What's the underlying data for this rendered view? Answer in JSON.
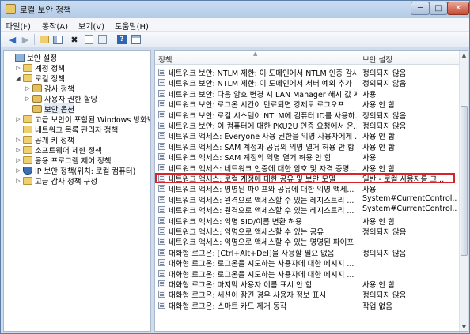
{
  "window": {
    "title": "로컬 보안 정책",
    "buttons": {
      "minimize": "─",
      "maximize": "□",
      "close": "✕"
    }
  },
  "menubar": {
    "items": [
      "파일(F)",
      "동작(A)",
      "보기(V)",
      "도움말(H)"
    ]
  },
  "toolbar": {
    "icons": [
      "back-icon",
      "forward-icon",
      "up-folder-icon",
      "show-hide-tree-icon",
      "delete-icon",
      "properties-icon",
      "export-list-icon",
      "help-icon",
      "view-icon"
    ]
  },
  "tree": {
    "items": [
      {
        "label": "보안 설정",
        "level": 0,
        "toggle": "",
        "icon": "computer-icon"
      },
      {
        "label": "계정 정책",
        "level": 1,
        "toggle": "▷",
        "icon": "folder-icon"
      },
      {
        "label": "로컬 정책",
        "level": 1,
        "toggle": "◢",
        "icon": "folder-icon"
      },
      {
        "label": "감사 정책",
        "level": 2,
        "toggle": "▷",
        "icon": "lock-folder-icon"
      },
      {
        "label": "사용자 권한 할당",
        "level": 2,
        "toggle": "▷",
        "icon": "lock-folder-icon"
      },
      {
        "label": "보안 옵션",
        "level": 2,
        "toggle": "",
        "icon": "lock-folder-icon",
        "selected": true
      },
      {
        "label": "고급 보안이 포함된 Windows 방화벽",
        "level": 1,
        "toggle": "▷",
        "icon": "folder-icon"
      },
      {
        "label": "네트워크 목록 관리자 정책",
        "level": 1,
        "toggle": "",
        "icon": "folder-icon"
      },
      {
        "label": "공개 키 정책",
        "level": 1,
        "toggle": "▷",
        "icon": "folder-icon"
      },
      {
        "label": "소프트웨어 제한 정책",
        "level": 1,
        "toggle": "▷",
        "icon": "folder-icon"
      },
      {
        "label": "응용 프로그램 제어 정책",
        "level": 1,
        "toggle": "▷",
        "icon": "folder-icon"
      },
      {
        "label": "IP 보안 정책(위치: 로컬 컴퓨터)",
        "level": 1,
        "toggle": "▷",
        "icon": "shield-icon"
      },
      {
        "label": "고급 감사 정책 구성",
        "level": 1,
        "toggle": "▷",
        "icon": "folder-icon"
      }
    ]
  },
  "list": {
    "columns": {
      "policy": "정책",
      "setting": "보안 설정"
    },
    "rows": [
      {
        "policy": "네트워크 보안: NTLM 제한: 이 도메인에서 NTLM 인증 감사",
        "setting": "정의되지 않음"
      },
      {
        "policy": "네트워크 보안: NTLM 제한: 이 도메인에서 서버 예외 추가",
        "setting": "정의되지 않음"
      },
      {
        "policy": "네트워크 보안: 다음 암호 변경 시 LAN Manager 해시 값 저...",
        "setting": "사용"
      },
      {
        "policy": "네트워크 보안: 로그온 시간이 만료되면 강제로 로그오프",
        "setting": "사용 안 함"
      },
      {
        "policy": "네트워크 보안: 로컬 시스템이 NTLM에 컴퓨터 ID를 사용하...",
        "setting": "정의되지 않음"
      },
      {
        "policy": "네트워크 보안: 이 컴퓨터에 대한 PKU2U 인증 요청에서 온...",
        "setting": "정의되지 않음"
      },
      {
        "policy": "네트워크 액세스: Everyone 사용 권한을 익명 사용자에게 ...",
        "setting": "사용 안 함"
      },
      {
        "policy": "네트워크 액세스: SAM 계정과 공유의 익명 열거 허용 안 함",
        "setting": "사용 안 함"
      },
      {
        "policy": "네트워크 액세스: SAM 계정의 익명 열거 허용 안 함",
        "setting": "사용"
      },
      {
        "policy": "네트워크 액세스: 네트워크 인증에 대한 암호 및 자격 증명...",
        "setting": "사용 안 함"
      },
      {
        "policy": "네트워크 액세스: 로컬 계정에 대한 공유 및 보안 모델",
        "setting": "일반 - 로컬 사용자를 그...",
        "highlighted": true
      },
      {
        "policy": "네트워크 액세스: 명명된 파이프와 공유에 대한 익명 액세...",
        "setting": "사용"
      },
      {
        "policy": "네트워크 액세스: 원격으로 액세스할 수 있는 레지스트리 ...",
        "setting": "System#CurrentControl..."
      },
      {
        "policy": "네트워크 액세스: 원격으로 액세스할 수 있는 레지스트리 ...",
        "setting": "System#CurrentControl..."
      },
      {
        "policy": "네트워크 액세스: 익명 SID/이름 변환 허용",
        "setting": "사용 안 함"
      },
      {
        "policy": "네트워크 액세스: 익명으로 액세스할 수 있는 공유",
        "setting": "정의되지 않음"
      },
      {
        "policy": "네트워크 액세스: 익명으로 액세스할 수 있는 명명된 파이프",
        "setting": ""
      },
      {
        "policy": "대화형 로그온: [Ctrl+Alt+Del]을 사용할 필요 없음",
        "setting": "정의되지 않음"
      },
      {
        "policy": "대화형 로그온: 로그온을 시도하는 사용자에 대한 메시지 ...",
        "setting": ""
      },
      {
        "policy": "대화형 로그온: 로그온을 시도하는 사용자에 대한 메시지 ...",
        "setting": ""
      },
      {
        "policy": "대화형 로그온: 마지막 사용자 이름 표시 안 함",
        "setting": "사용 안 함"
      },
      {
        "policy": "대화형 로그온: 세션이 잠긴 경우 사용자 정보 표시",
        "setting": "정의되지 않음"
      },
      {
        "policy": "대화형 로그온: 스마트 카드 제거 동작",
        "setting": "작업 없음"
      }
    ]
  }
}
